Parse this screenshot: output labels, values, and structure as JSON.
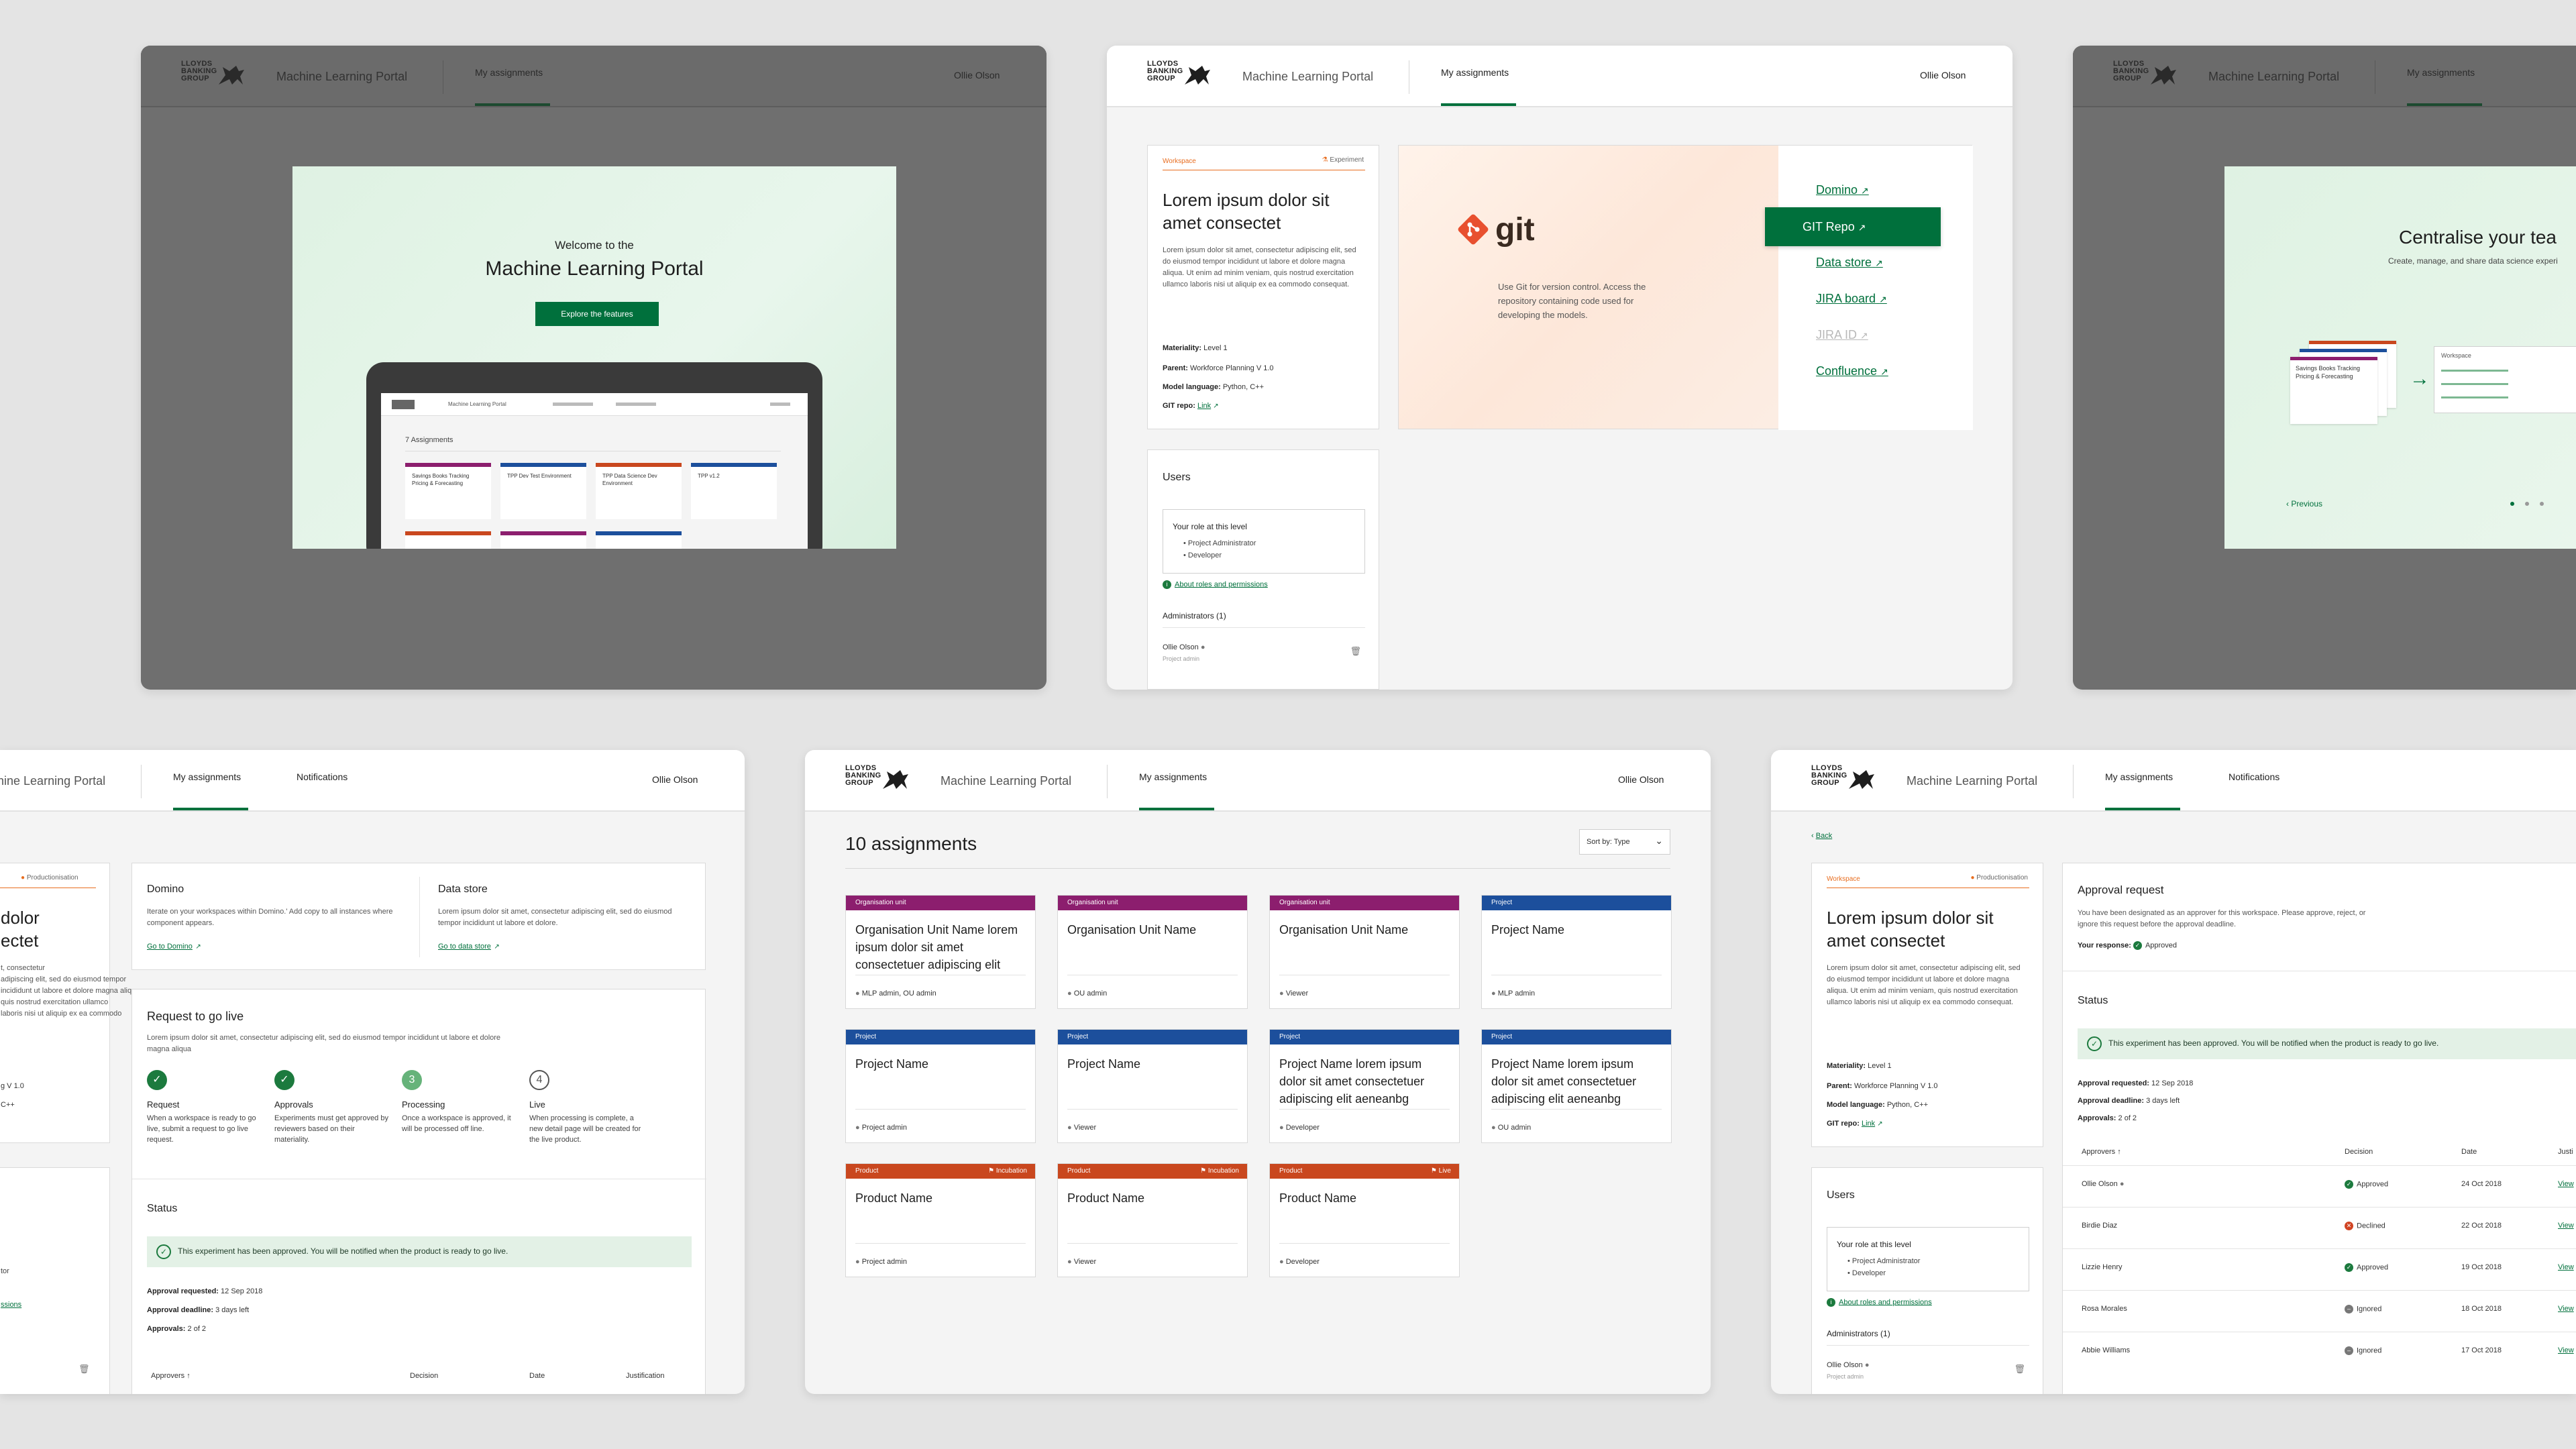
{
  "brand": {
    "logo_text": "LLOYDS BANKING GROUP",
    "portal": "Machine Learning Portal",
    "accent": "#00703c"
  },
  "nav": {
    "my_assignments": "My assignments",
    "notifications": "Notifications",
    "user": "Ollie Olson"
  },
  "welcome": {
    "line1": "Welcome to the",
    "title": "Machine Learning Portal",
    "cta": "Explore the features",
    "mock_count": "7 Assignments",
    "mock_cards": [
      "Savings Books Tracking Pricing & Forecasting",
      "TPP Dev Test Environment",
      "TPP Data Science Dev Environment",
      "TPP v1.2"
    ]
  },
  "workspace": {
    "tag": "Workspace",
    "stage": "Experiment",
    "stage_prod": "Productionisation",
    "title": "Lorem ipsum dolor sit amet consectet",
    "body": "Lorem ipsum dolor sit amet, consectetur adipiscing elit, sed do eiusmod tempor incididunt ut labore et dolore magna aliqua. Ut enim ad minim veniam, quis nostrud exercitation ullamco laboris nisi ut aliquip ex ea commodo consequat.",
    "materiality_label": "Materiality:",
    "materiality": "Level 1",
    "parent_label": "Parent:",
    "parent": "Workforce Planning V 1.0",
    "model_label": "Model language:",
    "model": "Python, C++",
    "git_label": "GIT repo:",
    "git": "Link"
  },
  "users": {
    "title": "Users",
    "role_title": "Your role at this level",
    "roles": [
      "Project Administrator",
      "Developer"
    ],
    "about": "About roles and permissions",
    "admins": "Administrators (1)",
    "admin_name": "Ollie Olson",
    "admin_role": "Project admin"
  },
  "tools": {
    "git_word": "git",
    "git_desc": "Use Git for version control. Access the repository containing code used for developing the models.",
    "links": [
      "Domino",
      "GIT Repo",
      "Data store",
      "JIRA board",
      "JIRA ID",
      "Confluence"
    ]
  },
  "centralise": {
    "title": "Centralise your tea",
    "sub": "Create, manage, and share data science experi",
    "prev": "Previous",
    "mini_card": "Savings Books Tracking Pricing & Forecasting",
    "mini_ws": "Workspace"
  },
  "golive": {
    "domino_title": "Domino",
    "domino_desc": "Iterate on your workspaces within Domino.' Add copy to all instances where component appears.",
    "domino_link": "Go to Domino",
    "ds_title": "Data store",
    "ds_desc": "Lorem ipsum dolor sit amet, consectetur adipiscing elit, sed do eiusmod tempor incididunt ut labore et dolore.",
    "ds_link": "Go to data store",
    "req_title": "Request to go live",
    "req_desc": "Lorem ipsum dolor sit amet, consectetur adipiscing elit, sed do eiusmod tempor incididunt ut labore et dolore magna aliqua",
    "steps": [
      {
        "title": "Request",
        "desc": "When a workspace is ready to go live, submit a request to go live request."
      },
      {
        "title": "Approvals",
        "desc": "Experiments must get approved by reviewers based on their materiality."
      },
      {
        "title": "Processing",
        "desc": "Once a workspace is approved, it will be processed off line."
      },
      {
        "title": "Live",
        "desc": "When processing is complete, a new detail page will be created for the live product."
      }
    ],
    "step_numbers": [
      "3",
      "4"
    ],
    "status": "Status",
    "status_msg": "This experiment has been approved. You will be notified when the product is ready to go live.",
    "requested_label": "Approval requested:",
    "requested": "12 Sep 2018",
    "deadline_label": "Approval deadline:",
    "deadline": "3 days left",
    "approvals_label": "Approvals:",
    "approvals": "2 of 2",
    "cols": [
      "Approvers",
      "Decision",
      "Date",
      "Justification"
    ],
    "partial": {
      "title_a": "dolor",
      "title_b": "ectet",
      "body": [
        "t, consectetur",
        "adipiscing elit, sed do eiusmod tempor",
        "incididunt ut labore et dolore magna aliqua.",
        "quis nostrud exercitation ullamco",
        "laboris nisi ut aliquip ex ea commodo"
      ],
      "meta": [
        "g V 1.0",
        "C++"
      ],
      "role": "tor",
      "about": "ssions"
    }
  },
  "assignments": {
    "title": "10 assignments",
    "sort": "Sort by: Type",
    "cards": [
      {
        "type": "Organisation unit",
        "title": "Organisation Unit Name lorem ipsum dolor sit amet consectetuer adipiscing elit",
        "role": "MLP admin, OU admin",
        "badge": ""
      },
      {
        "type": "Organisation unit",
        "title": "Organisation Unit Name",
        "role": "OU admin",
        "badge": ""
      },
      {
        "type": "Organisation unit",
        "title": "Organisation Unit Name",
        "role": "Viewer",
        "badge": ""
      },
      {
        "type": "Project",
        "title": "Project Name",
        "role": "MLP admin",
        "badge": ""
      },
      {
        "type": "Project",
        "title": "Project Name",
        "role": "Project admin",
        "badge": ""
      },
      {
        "type": "Project",
        "title": "Project Name",
        "role": "Viewer",
        "badge": ""
      },
      {
        "type": "Project",
        "title": "Project Name lorem ipsum dolor sit amet consectetuer adipiscing elit aeneanbg",
        "role": "Developer",
        "badge": ""
      },
      {
        "type": "Project",
        "title": "Project Name lorem ipsum dolor sit amet consectetuer adipiscing elit aeneanbg",
        "role": "OU admin",
        "badge": ""
      },
      {
        "type": "Product",
        "title": "Product Name",
        "role": "Project admin",
        "badge": "Incubation"
      },
      {
        "type": "Product",
        "title": "Product Name",
        "role": "Viewer",
        "badge": "Incubation"
      },
      {
        "type": "Product",
        "title": "Product Name",
        "role": "Developer",
        "badge": "Live"
      }
    ]
  },
  "approval": {
    "back": "Back",
    "title": "Approval request",
    "desc": "You have been designated as an approver for this workspace. Please approve, reject, or ignore this request before the approval deadline.",
    "response_label": "Your response:",
    "response": "Approved",
    "rows": [
      {
        "name": "Ollie Olson",
        "decision": "Approved",
        "date": "24 Oct 2018",
        "kind": "ok"
      },
      {
        "name": "Birdie Diaz",
        "decision": "Declined",
        "date": "22 Oct 2018",
        "kind": "no"
      },
      {
        "name": "Lizzie Henry",
        "decision": "Approved",
        "date": "19 Oct 2018",
        "kind": "ok"
      },
      {
        "name": "Rosa Morales",
        "decision": "Ignored",
        "date": "18 Oct 2018",
        "kind": "ig"
      },
      {
        "name": "Abbie Williams",
        "decision": "Ignored",
        "date": "17 Oct 2018",
        "kind": "ig"
      }
    ],
    "view": "View",
    "cols": [
      "Approvers",
      "Decision",
      "Date",
      "Justi"
    ]
  }
}
